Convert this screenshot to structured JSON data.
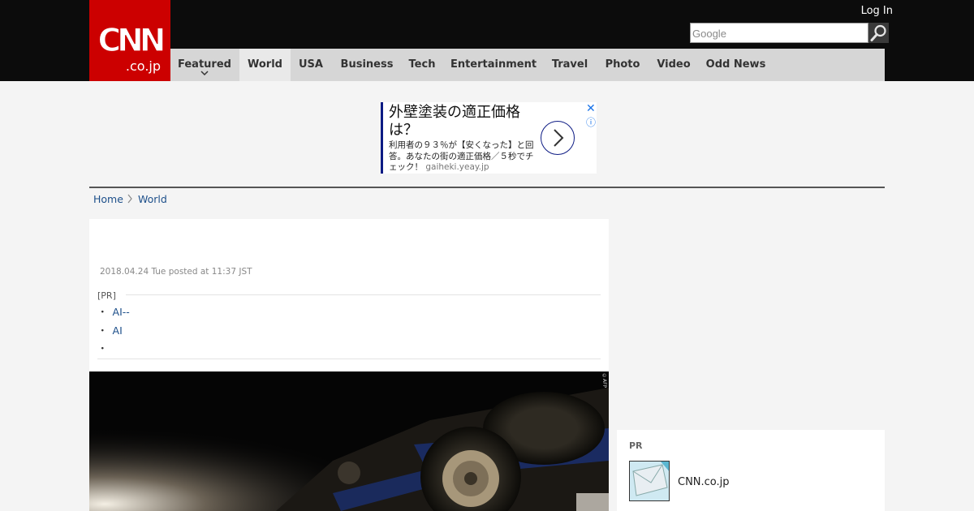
{
  "header": {
    "logo_text": "CNN .co.jp",
    "login_label": "Log In",
    "search_placeholder": "Google"
  },
  "nav": {
    "items": [
      "Featured",
      "World",
      "USA",
      "Business",
      "Tech",
      "Entertainment",
      "Travel",
      "Photo",
      "Video",
      "Odd News"
    ],
    "active": "World"
  },
  "ad": {
    "title": "外壁塗装の適正価格は？",
    "description": "利用者の９３％が【安くなった】と回答。あなたの街の適正価格／５秒でチェック！",
    "domain": "gaiheki.yeay.jp",
    "close_icon": "close-icon",
    "info_icon": "info-icon",
    "accent_color": "#0d1b84"
  },
  "breadcrumb": {
    "home": "Home",
    "current": "World"
  },
  "article": {
    "date": "2018.04.24 Tue posted at 11:37 JST",
    "pr_label": "[PR]",
    "pr_items": [
      "AI--",
      "AI",
      ""
    ]
  },
  "photo": {
    "credit": "©AFP"
  },
  "side_pr": {
    "label": "PR",
    "text": "CNN.co.jp"
  },
  "colors": {
    "brand_red": "#cc0000",
    "header_bg": "#0c0c0c",
    "nav_bg": "#d6d6d6",
    "link": "#1d4f8a"
  }
}
